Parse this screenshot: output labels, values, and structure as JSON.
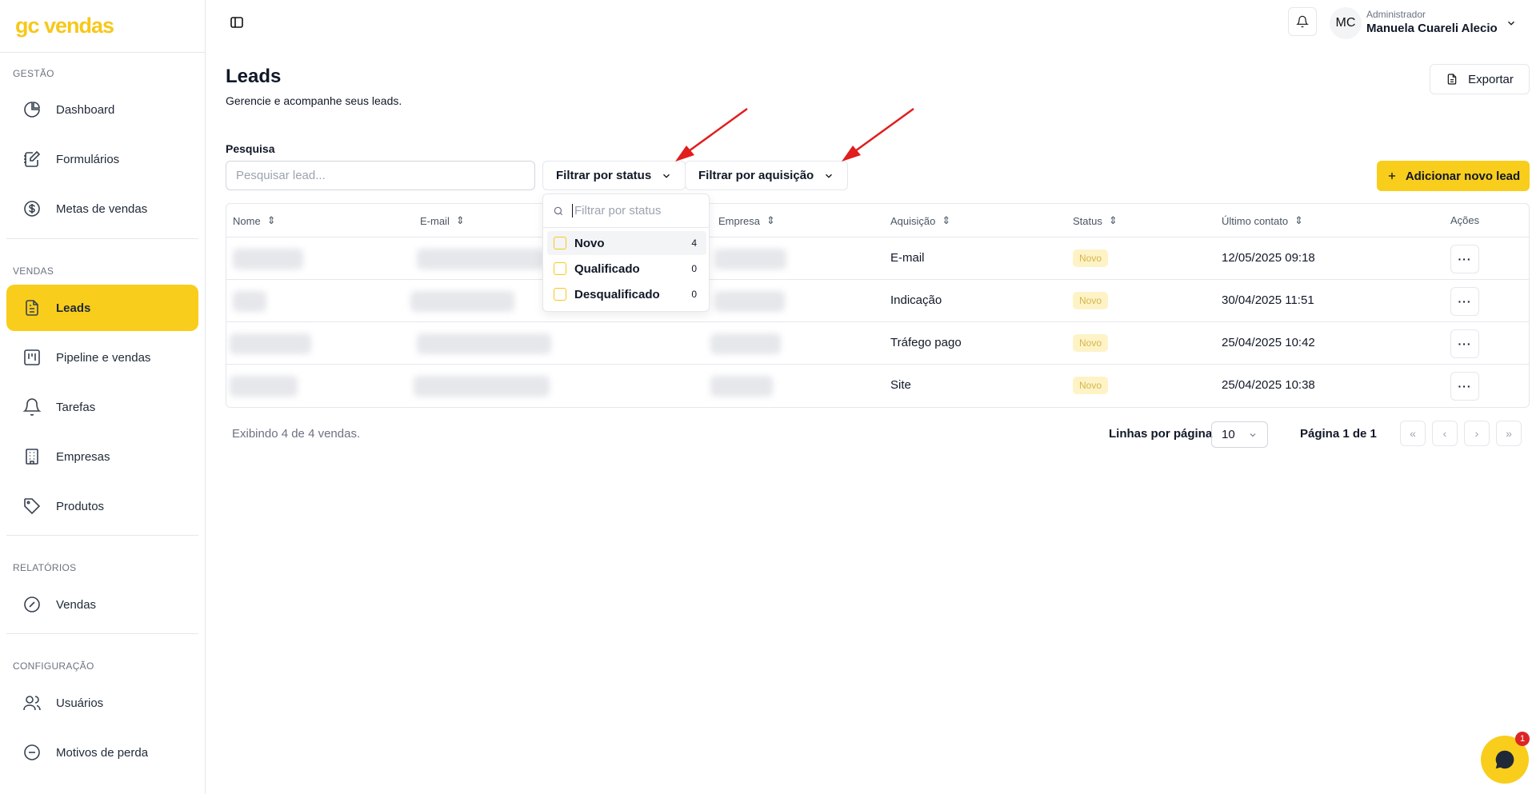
{
  "app": {
    "logo": "gc vendas"
  },
  "sidebar": {
    "sections": [
      {
        "label": "GESTÃO"
      },
      {
        "label": "VENDAS"
      },
      {
        "label": "RELATÓRIOS"
      },
      {
        "label": "CONFIGURAÇÃO"
      }
    ],
    "items": [
      {
        "label": "Dashboard",
        "icon": "pie-chart-icon"
      },
      {
        "label": "Formulários",
        "icon": "form-icon"
      },
      {
        "label": "Metas de vendas",
        "icon": "dollar-circle-icon"
      },
      {
        "label": "Leads",
        "icon": "document-icon",
        "active": true
      },
      {
        "label": "Pipeline e vendas",
        "icon": "kanban-icon"
      },
      {
        "label": "Tarefas",
        "icon": "bell-icon"
      },
      {
        "label": "Empresas",
        "icon": "building-icon"
      },
      {
        "label": "Produtos",
        "icon": "tag-icon"
      },
      {
        "label": "Vendas",
        "icon": "percent-circle-icon"
      },
      {
        "label": "Usuários",
        "icon": "users-icon"
      },
      {
        "label": "Motivos de perda",
        "icon": "minus-circle-icon"
      }
    ]
  },
  "header": {
    "user": {
      "initials": "MC",
      "role": "Administrador",
      "name": "Manuela Cuareli Alecio"
    }
  },
  "page": {
    "title": "Leads",
    "subtitle": "Gerencie e acompanhe seus leads.",
    "export_label": "Exportar",
    "search_label": "Pesquisa",
    "search_placeholder": "Pesquisar lead...",
    "filter_status_label": "Filtrar por status",
    "filter_acquisition_label": "Filtrar por aquisição",
    "add_label": "Adicionar novo lead"
  },
  "table": {
    "columns": [
      "Nome",
      "E-mail",
      "Empresa",
      "Aquisição",
      "Status",
      "Último contato",
      "Ações"
    ],
    "rows": [
      {
        "aquisicao": "E-mail",
        "status": "Novo",
        "ultimo_contato": "12/05/2025 09:18"
      },
      {
        "aquisicao": "Indicação",
        "status": "Novo",
        "ultimo_contato": "30/04/2025 11:51"
      },
      {
        "aquisicao": "Tráfego pago",
        "status": "Novo",
        "ultimo_contato": "25/04/2025 10:42"
      },
      {
        "aquisicao": "Site",
        "status": "Novo",
        "ultimo_contato": "25/04/2025 10:38"
      }
    ],
    "actions_glyph": "···"
  },
  "footer": {
    "showing": "Exibindo 4 de 4 vendas.",
    "rows_per_page_label": "Linhas por página",
    "rows_per_page_value": "10",
    "page_info": "Página 1 de 1"
  },
  "status_dropdown": {
    "placeholder": "Filtrar por status",
    "options": [
      {
        "label": "Novo",
        "count": "4"
      },
      {
        "label": "Qualificado",
        "count": "0"
      },
      {
        "label": "Desqualificado",
        "count": "0"
      }
    ]
  },
  "chat": {
    "badge": "1"
  },
  "colors": {
    "accent": "#f9cd1c",
    "logo": "#f7c81b",
    "arrow": "#e11d1d"
  }
}
